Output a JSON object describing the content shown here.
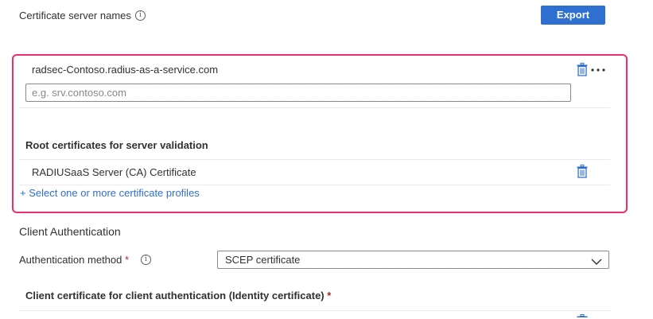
{
  "header": {
    "title": "Certificate server names",
    "info_glyph": "i",
    "export_label": "Export"
  },
  "server_names": {
    "value": "radsec-Contoso.radius-as-a-service.com",
    "placeholder": "e.g. srv.contoso.com",
    "more_glyph": "•••"
  },
  "root_certs": {
    "heading": "Root certificates for server validation",
    "items": [
      {
        "label": "RADIUSaaS Server (CA) Certificate"
      }
    ],
    "add_link": "+ Select one or more certificate profiles"
  },
  "client_auth": {
    "section_title": "Client Authentication",
    "method_label": "Authentication method",
    "required_mark": "*",
    "info_glyph": "i",
    "method_value": "SCEP certificate",
    "identity_heading": "Client certificate for client authentication (Identity certificate)",
    "identity_required_mark": "*"
  },
  "colors": {
    "accent": "#2f6fd0",
    "highlight": "#e8306b",
    "required": "#a4262c"
  },
  "icons": [
    "info-icon",
    "trash-icon",
    "more-icon",
    "chevron-down-icon"
  ]
}
